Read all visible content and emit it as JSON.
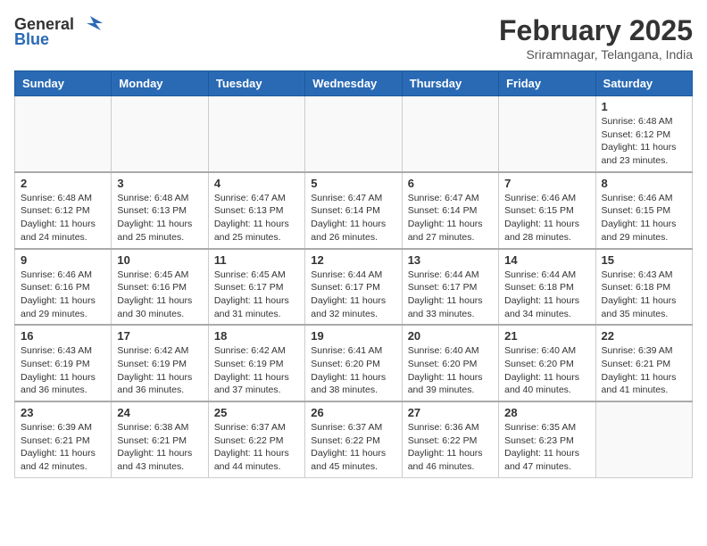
{
  "header": {
    "logo_general": "General",
    "logo_blue": "Blue",
    "month": "February 2025",
    "location": "Sriramnagar, Telangana, India"
  },
  "weekdays": [
    "Sunday",
    "Monday",
    "Tuesday",
    "Wednesday",
    "Thursday",
    "Friday",
    "Saturday"
  ],
  "weeks": [
    [
      {
        "day": "",
        "info": ""
      },
      {
        "day": "",
        "info": ""
      },
      {
        "day": "",
        "info": ""
      },
      {
        "day": "",
        "info": ""
      },
      {
        "day": "",
        "info": ""
      },
      {
        "day": "",
        "info": ""
      },
      {
        "day": "1",
        "info": "Sunrise: 6:48 AM\nSunset: 6:12 PM\nDaylight: 11 hours\nand 23 minutes."
      }
    ],
    [
      {
        "day": "2",
        "info": "Sunrise: 6:48 AM\nSunset: 6:12 PM\nDaylight: 11 hours\nand 24 minutes."
      },
      {
        "day": "3",
        "info": "Sunrise: 6:48 AM\nSunset: 6:13 PM\nDaylight: 11 hours\nand 25 minutes."
      },
      {
        "day": "4",
        "info": "Sunrise: 6:47 AM\nSunset: 6:13 PM\nDaylight: 11 hours\nand 25 minutes."
      },
      {
        "day": "5",
        "info": "Sunrise: 6:47 AM\nSunset: 6:14 PM\nDaylight: 11 hours\nand 26 minutes."
      },
      {
        "day": "6",
        "info": "Sunrise: 6:47 AM\nSunset: 6:14 PM\nDaylight: 11 hours\nand 27 minutes."
      },
      {
        "day": "7",
        "info": "Sunrise: 6:46 AM\nSunset: 6:15 PM\nDaylight: 11 hours\nand 28 minutes."
      },
      {
        "day": "8",
        "info": "Sunrise: 6:46 AM\nSunset: 6:15 PM\nDaylight: 11 hours\nand 29 minutes."
      }
    ],
    [
      {
        "day": "9",
        "info": "Sunrise: 6:46 AM\nSunset: 6:16 PM\nDaylight: 11 hours\nand 29 minutes."
      },
      {
        "day": "10",
        "info": "Sunrise: 6:45 AM\nSunset: 6:16 PM\nDaylight: 11 hours\nand 30 minutes."
      },
      {
        "day": "11",
        "info": "Sunrise: 6:45 AM\nSunset: 6:17 PM\nDaylight: 11 hours\nand 31 minutes."
      },
      {
        "day": "12",
        "info": "Sunrise: 6:44 AM\nSunset: 6:17 PM\nDaylight: 11 hours\nand 32 minutes."
      },
      {
        "day": "13",
        "info": "Sunrise: 6:44 AM\nSunset: 6:17 PM\nDaylight: 11 hours\nand 33 minutes."
      },
      {
        "day": "14",
        "info": "Sunrise: 6:44 AM\nSunset: 6:18 PM\nDaylight: 11 hours\nand 34 minutes."
      },
      {
        "day": "15",
        "info": "Sunrise: 6:43 AM\nSunset: 6:18 PM\nDaylight: 11 hours\nand 35 minutes."
      }
    ],
    [
      {
        "day": "16",
        "info": "Sunrise: 6:43 AM\nSunset: 6:19 PM\nDaylight: 11 hours\nand 36 minutes."
      },
      {
        "day": "17",
        "info": "Sunrise: 6:42 AM\nSunset: 6:19 PM\nDaylight: 11 hours\nand 36 minutes."
      },
      {
        "day": "18",
        "info": "Sunrise: 6:42 AM\nSunset: 6:19 PM\nDaylight: 11 hours\nand 37 minutes."
      },
      {
        "day": "19",
        "info": "Sunrise: 6:41 AM\nSunset: 6:20 PM\nDaylight: 11 hours\nand 38 minutes."
      },
      {
        "day": "20",
        "info": "Sunrise: 6:40 AM\nSunset: 6:20 PM\nDaylight: 11 hours\nand 39 minutes."
      },
      {
        "day": "21",
        "info": "Sunrise: 6:40 AM\nSunset: 6:20 PM\nDaylight: 11 hours\nand 40 minutes."
      },
      {
        "day": "22",
        "info": "Sunrise: 6:39 AM\nSunset: 6:21 PM\nDaylight: 11 hours\nand 41 minutes."
      }
    ],
    [
      {
        "day": "23",
        "info": "Sunrise: 6:39 AM\nSunset: 6:21 PM\nDaylight: 11 hours\nand 42 minutes."
      },
      {
        "day": "24",
        "info": "Sunrise: 6:38 AM\nSunset: 6:21 PM\nDaylight: 11 hours\nand 43 minutes."
      },
      {
        "day": "25",
        "info": "Sunrise: 6:37 AM\nSunset: 6:22 PM\nDaylight: 11 hours\nand 44 minutes."
      },
      {
        "day": "26",
        "info": "Sunrise: 6:37 AM\nSunset: 6:22 PM\nDaylight: 11 hours\nand 45 minutes."
      },
      {
        "day": "27",
        "info": "Sunrise: 6:36 AM\nSunset: 6:22 PM\nDaylight: 11 hours\nand 46 minutes."
      },
      {
        "day": "28",
        "info": "Sunrise: 6:35 AM\nSunset: 6:23 PM\nDaylight: 11 hours\nand 47 minutes."
      },
      {
        "day": "",
        "info": ""
      }
    ]
  ]
}
